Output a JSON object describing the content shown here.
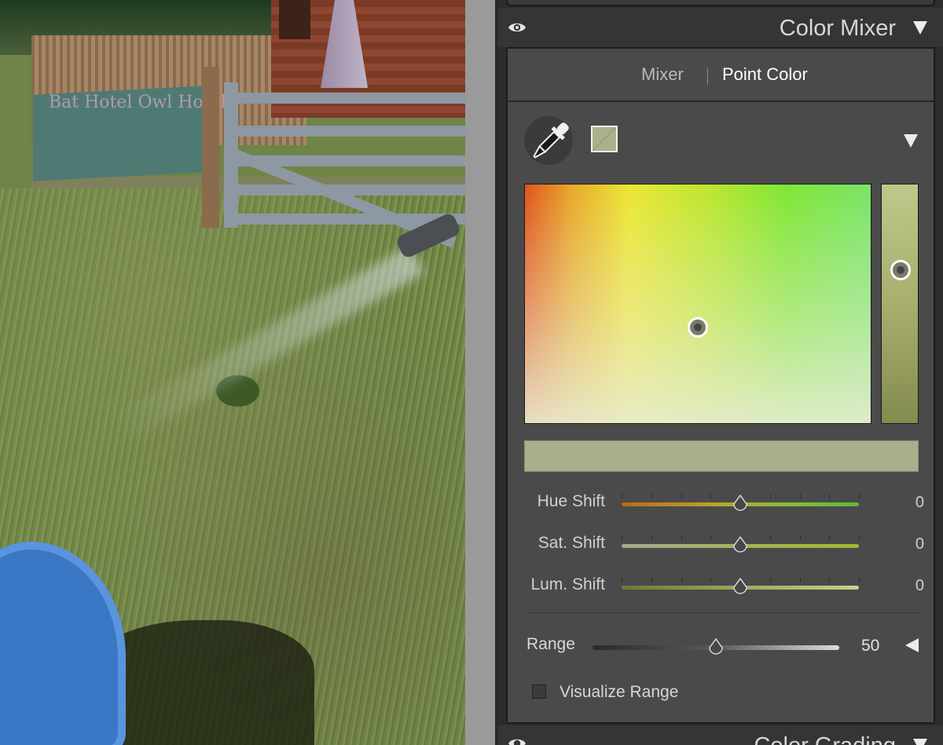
{
  "panel": {
    "section_title": "Color Mixer",
    "tabs": [
      {
        "label": "Mixer",
        "active": false
      },
      {
        "label": "Point Color",
        "active": true
      }
    ],
    "swatch_color": "#a9b28a",
    "sampled_color": "#abae8b",
    "color_field_point": {
      "hue_fraction": 0.5,
      "saturation_fraction": 0.6
    },
    "luminance_fraction": 0.36,
    "sliders": [
      {
        "label": "Hue Shift",
        "value": "0",
        "level": 0.5
      },
      {
        "label": "Sat. Shift",
        "value": "0",
        "level": 0.5
      },
      {
        "label": "Lum. Shift",
        "value": "0",
        "level": 0.5
      }
    ],
    "range": {
      "label": "Range",
      "value": "50",
      "level": 0.5
    },
    "visualize_range": {
      "label": "Visualize Range",
      "checked": false
    },
    "next_section_title": "Color Grading"
  },
  "photo": {
    "board_text": "Bat Hotel  Owl Hotel"
  },
  "icons": {
    "eye": "eye-icon",
    "collapse": "triangle-down-icon",
    "eyedropper": "eyedropper-icon",
    "range_toggle": "triangle-left-icon"
  }
}
